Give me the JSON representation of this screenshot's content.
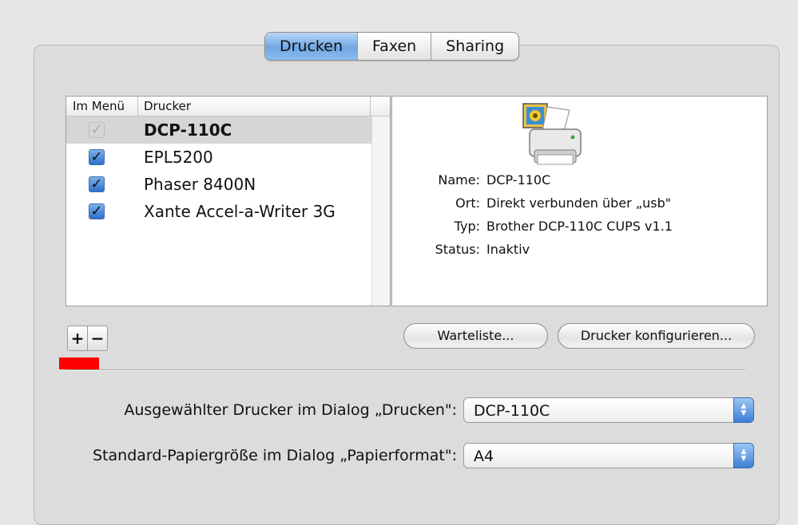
{
  "tabs": [
    {
      "label": "Drucken",
      "active": true
    },
    {
      "label": "Faxen",
      "active": false
    },
    {
      "label": "Sharing",
      "active": false
    }
  ],
  "printer_list": {
    "headers": {
      "menu": "Im Menü",
      "printer": "Drucker"
    },
    "rows": [
      {
        "name": "DCP-110C",
        "checked": true,
        "disabled": true,
        "selected": true
      },
      {
        "name": "EPL5200",
        "checked": true,
        "disabled": false,
        "selected": false
      },
      {
        "name": "Phaser 8400N",
        "checked": true,
        "disabled": false,
        "selected": false
      },
      {
        "name": "Xante Accel-a-Writer 3G",
        "checked": true,
        "disabled": false,
        "selected": false
      }
    ]
  },
  "details": {
    "name_label": "Name:",
    "name_value": "DCP-110C",
    "location_label": "Ort:",
    "location_value": "Direkt verbunden über „usb\"",
    "type_label": "Typ:",
    "type_value": "Brother DCP-110C CUPS v1.1",
    "status_label": "Status:",
    "status_value": "Inaktiv"
  },
  "buttons": {
    "add": "+",
    "remove": "−",
    "queue": "Warteliste...",
    "configure": "Drucker konfigurieren..."
  },
  "options": {
    "selected_printer_label": "Ausgewählter Drucker im Dialog „Drucken\":",
    "selected_printer_value": "DCP-110C",
    "paper_size_label": "Standard-Papiergröße im Dialog „Papierformat\":",
    "paper_size_value": "A4"
  },
  "colors": {
    "accent": "#6fa6e3",
    "marker": "#ff0000"
  }
}
